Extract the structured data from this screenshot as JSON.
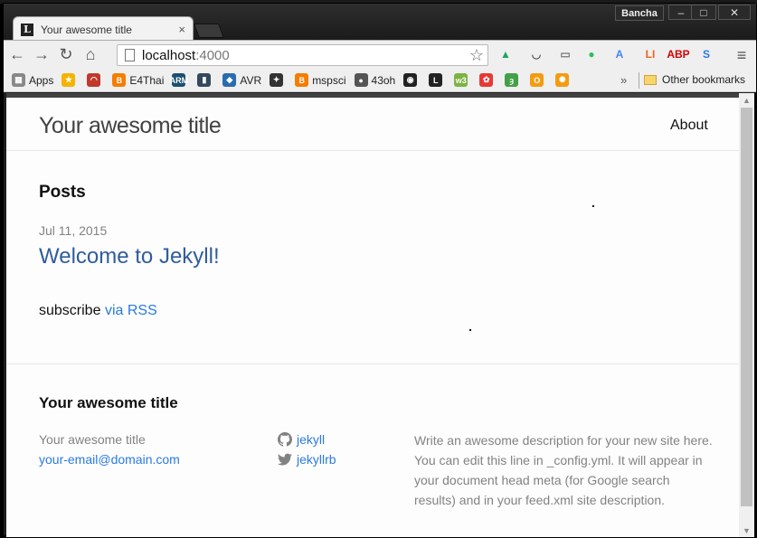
{
  "browser": {
    "tab_title": "Your awesome title",
    "tab_favicon_letter": "L",
    "tab_close": "×",
    "profile_name": "Bancha",
    "url_host": "localhost",
    "url_port": ":4000",
    "nav_back": "←",
    "nav_forward": "→",
    "nav_reload": "↻",
    "nav_home": "⌂",
    "star": "☆",
    "extensions": [
      {
        "name": "drive-icon",
        "glyph": "▲",
        "color": "#1fa463"
      },
      {
        "name": "pocket-icon",
        "glyph": "◡",
        "color": "#555555"
      },
      {
        "name": "cast-icon",
        "glyph": "▭",
        "color": "#777777"
      },
      {
        "name": "evernote-icon",
        "glyph": "●",
        "color": "#2dbe60"
      },
      {
        "name": "translate-icon",
        "glyph": "A",
        "color": "#4285f4"
      },
      {
        "name": "lastpass-icon",
        "glyph": "LI",
        "color": "#f26122"
      },
      {
        "name": "adblock-icon",
        "glyph": "ABP",
        "color": "#d40000"
      },
      {
        "name": "s-extension-icon",
        "glyph": "S",
        "color": "#2a7ae2"
      }
    ],
    "menu": "≡"
  },
  "bookmarks": {
    "items": [
      {
        "label": "Apps",
        "icon": "apps-grid-icon",
        "color": "#888888",
        "glyph": "▦"
      },
      {
        "label": "",
        "icon": "star-bookmark-icon",
        "color": "#f4b400",
        "glyph": "★"
      },
      {
        "label": "",
        "icon": "arc-bookmark-icon",
        "color": "#c0392b",
        "glyph": "◠"
      },
      {
        "label": "E4Thai",
        "icon": "blogger-icon",
        "color": "#f57d00",
        "glyph": "B"
      },
      {
        "label": "",
        "icon": "arm-icon",
        "color": "#1b4f72",
        "glyph": "ARM"
      },
      {
        "label": "",
        "icon": "book-icon",
        "color": "#34495e",
        "glyph": "▮"
      },
      {
        "label": "AVR",
        "icon": "avr-icon",
        "color": "#2a6cb0",
        "glyph": "◆"
      },
      {
        "label": "",
        "icon": "ti-icon",
        "color": "#333333",
        "glyph": "✦"
      },
      {
        "label": "mspsci",
        "icon": "blogger-icon",
        "color": "#f57d00",
        "glyph": "B"
      },
      {
        "label": "43oh",
        "icon": "43oh-icon",
        "color": "#555555",
        "glyph": "●"
      },
      {
        "label": "",
        "icon": "github-icon",
        "color": "#222222",
        "glyph": "◉"
      },
      {
        "label": "",
        "icon": "lifehacker-icon",
        "color": "#222222",
        "glyph": "L"
      },
      {
        "label": "",
        "icon": "w3-icon",
        "color": "#7cb342",
        "glyph": "w3"
      },
      {
        "label": "",
        "icon": "puzzle-icon",
        "color": "#e53935",
        "glyph": "✿"
      },
      {
        "label": "",
        "icon": "e-icon",
        "color": "#43a047",
        "glyph": "ȝ"
      },
      {
        "label": "",
        "icon": "ring-icon",
        "color": "#f39c12",
        "glyph": "O"
      },
      {
        "label": "",
        "icon": "sun-icon",
        "color": "#f39c12",
        "glyph": "✺"
      }
    ],
    "overflow": "»",
    "other": "Other bookmarks"
  },
  "site": {
    "title": "Your awesome title",
    "nav": {
      "about": "About"
    },
    "posts_heading": "Posts",
    "posts": [
      {
        "date": "Jul 11, 2015",
        "title": "Welcome to Jekyll!"
      }
    ],
    "rss_prefix": "subscribe",
    "rss_link": "via RSS",
    "footer": {
      "heading": "Your awesome title",
      "name": "Your awesome title",
      "email": "your-email@domain.com",
      "github": "jekyll",
      "twitter": "jekyllrb",
      "description": "Write an awesome description for your new site here. You can edit this line in _config.yml. It will appear in your document head meta (for Google search results) and in your feed.xml site description."
    }
  }
}
